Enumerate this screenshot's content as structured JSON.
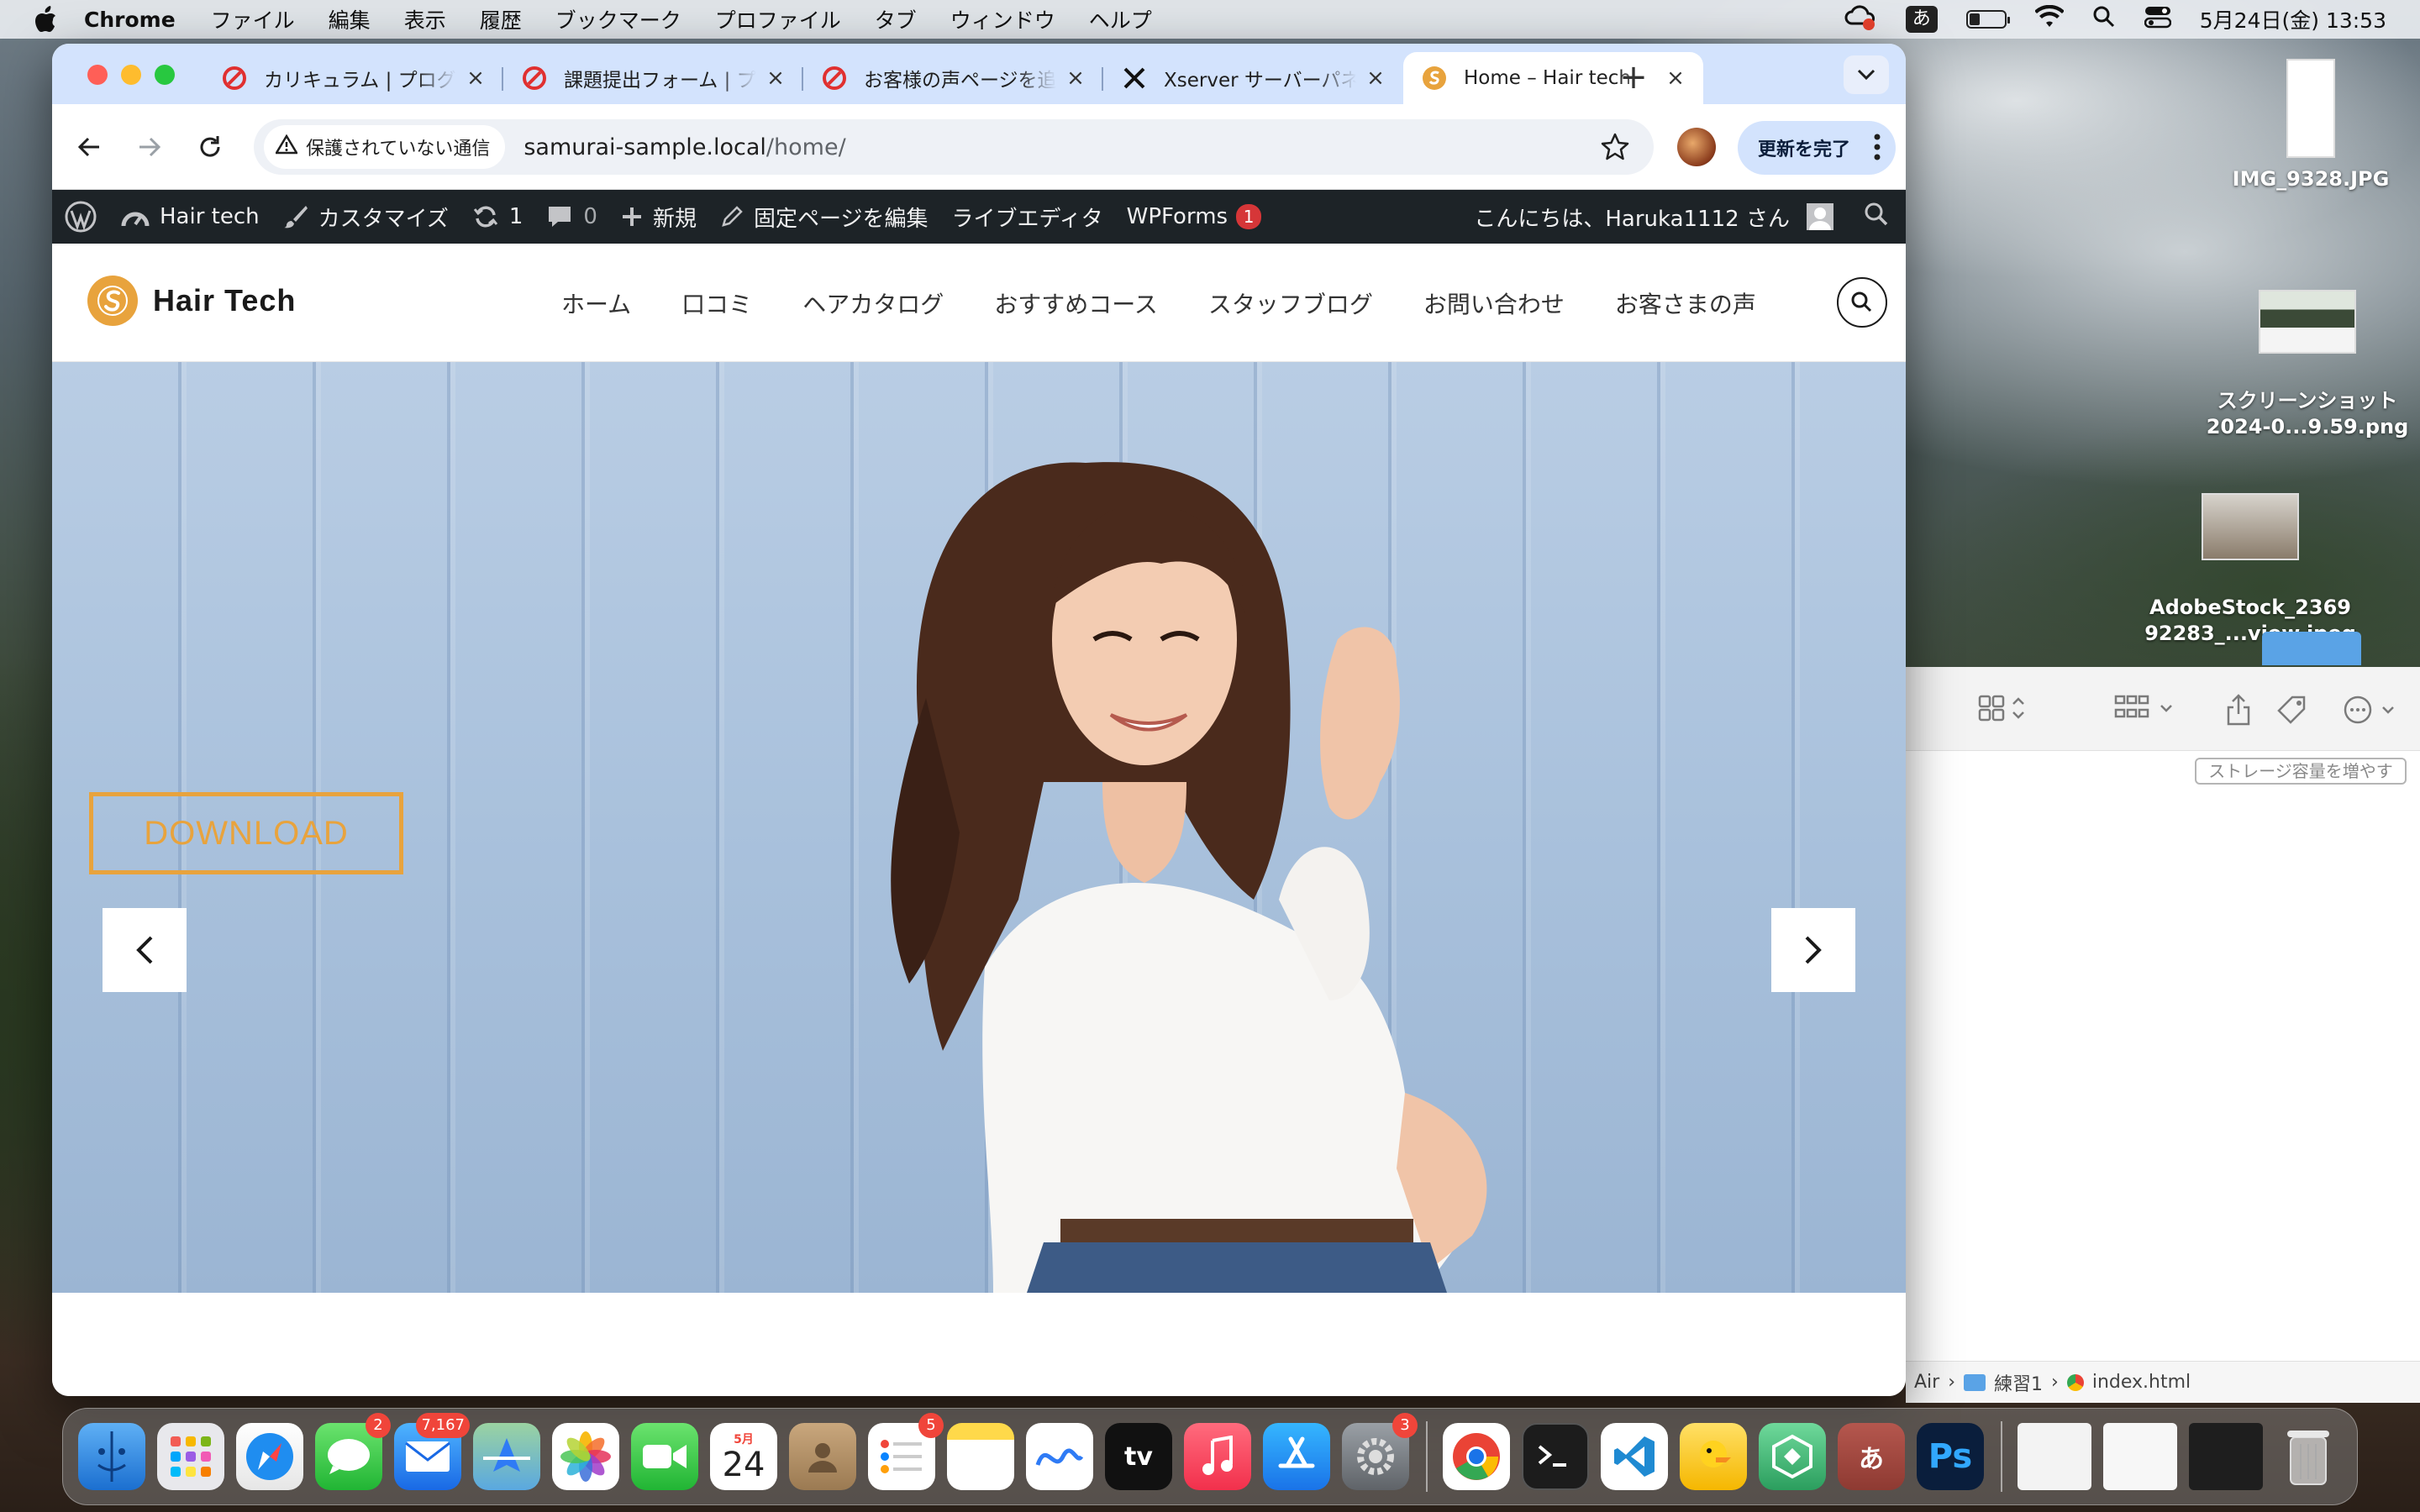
{
  "menubar": {
    "app_name": "Chrome",
    "items": [
      "ファイル",
      "編集",
      "表示",
      "履歴",
      "ブックマーク",
      "プロファイル",
      "タブ",
      "ウィンドウ",
      "ヘルプ"
    ],
    "ime": "あ",
    "datetime": "5月24日(金)  13:53"
  },
  "browser": {
    "tabs": [
      {
        "title": "カリキュラム | プログラミング",
        "favicon": "samurai-icon",
        "active": false
      },
      {
        "title": "課題提出フォーム | プログラミング",
        "favicon": "samurai-icon",
        "active": false
      },
      {
        "title": "お客様の声ページを追加",
        "favicon": "samurai-icon",
        "active": false
      },
      {
        "title": "Xserver サーバーパネル",
        "favicon": "x-icon",
        "active": false
      },
      {
        "title": "Home – Hair tech",
        "favicon": "hairtech-icon",
        "active": true
      }
    ],
    "new_tab": "+",
    "security_label": "保護されていない通信",
    "url_host": "samurai-sample.local",
    "url_path": "/home/",
    "update_label": "更新を完了"
  },
  "adminbar": {
    "site_name": "Hair tech",
    "customize": "カスタマイズ",
    "updates_count": "1",
    "comments_count": "0",
    "new_label": "新規",
    "edit_page": "固定ページを編集",
    "live_editor": "ライブエディタ",
    "wpforms": "WPForms",
    "wpforms_badge": "1",
    "greeting": "こんにちは、Haruka1112 さん"
  },
  "site": {
    "logo_text": "Hair Tech",
    "nav": [
      "ホーム",
      "口コミ",
      "ヘアカタログ",
      "おすすめコース",
      "スタッフブログ",
      "お問い合わせ",
      "お客さまの声"
    ],
    "hero_button": "DOWNLOAD"
  },
  "desktop": {
    "files": [
      {
        "name": "IMG_9328.JPG"
      },
      {
        "name": "スクリーンショット\n2024-0...9.59.png"
      },
      {
        "name": "AdobeStock_2369\n92283_...view.jpeg"
      }
    ]
  },
  "finder": {
    "storage_button": "ストレージ容量を増やす",
    "path": [
      "Air",
      "練習1",
      "index.html"
    ]
  },
  "dock": {
    "badges": {
      "messages": "2",
      "mail": "7,167",
      "reminders": "5",
      "settings": "3"
    },
    "calendar_month": "5月",
    "calendar_day": "24",
    "tv_label": "tv",
    "ime_label": "あ",
    "ps_label": "Ps"
  },
  "colors": {
    "accent": "#e8a33d",
    "adminbar_bg": "#1d2327",
    "tabstrip_bg": "#d3e3fd"
  }
}
